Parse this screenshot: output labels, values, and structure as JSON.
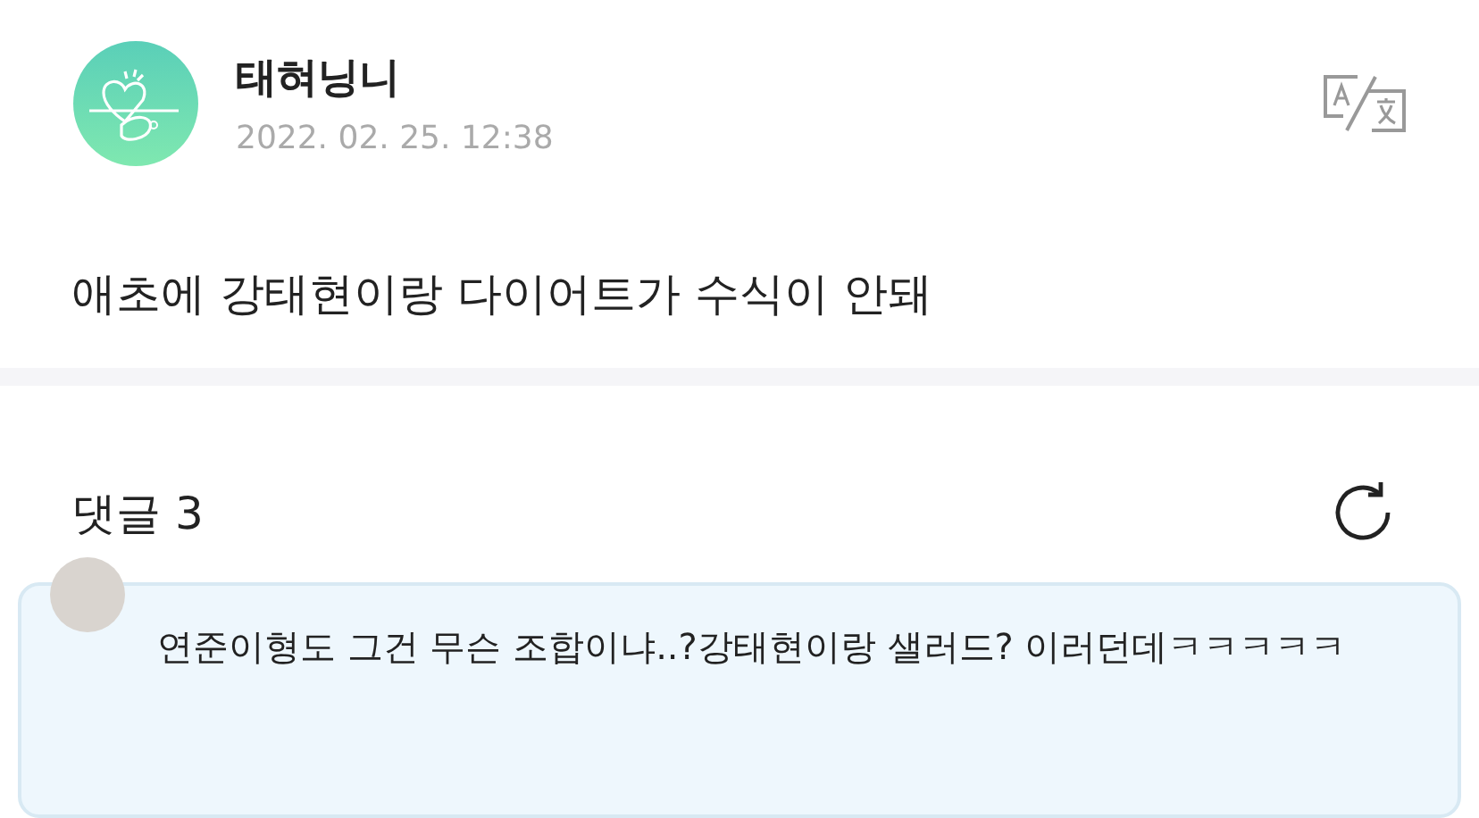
{
  "post": {
    "author": "태혀닝니",
    "date": "2022. 02. 25. 12:38",
    "body": "애초에 강태현이랑 다이어트가 수식이 안돼"
  },
  "comments": {
    "label": "댓글 3",
    "items": [
      {
        "text": "연준이형도 그건 무슨 조합이냐..?강태현이랑 샐러드? 이러던데ㅋㅋㅋㅋㅋ"
      }
    ]
  }
}
